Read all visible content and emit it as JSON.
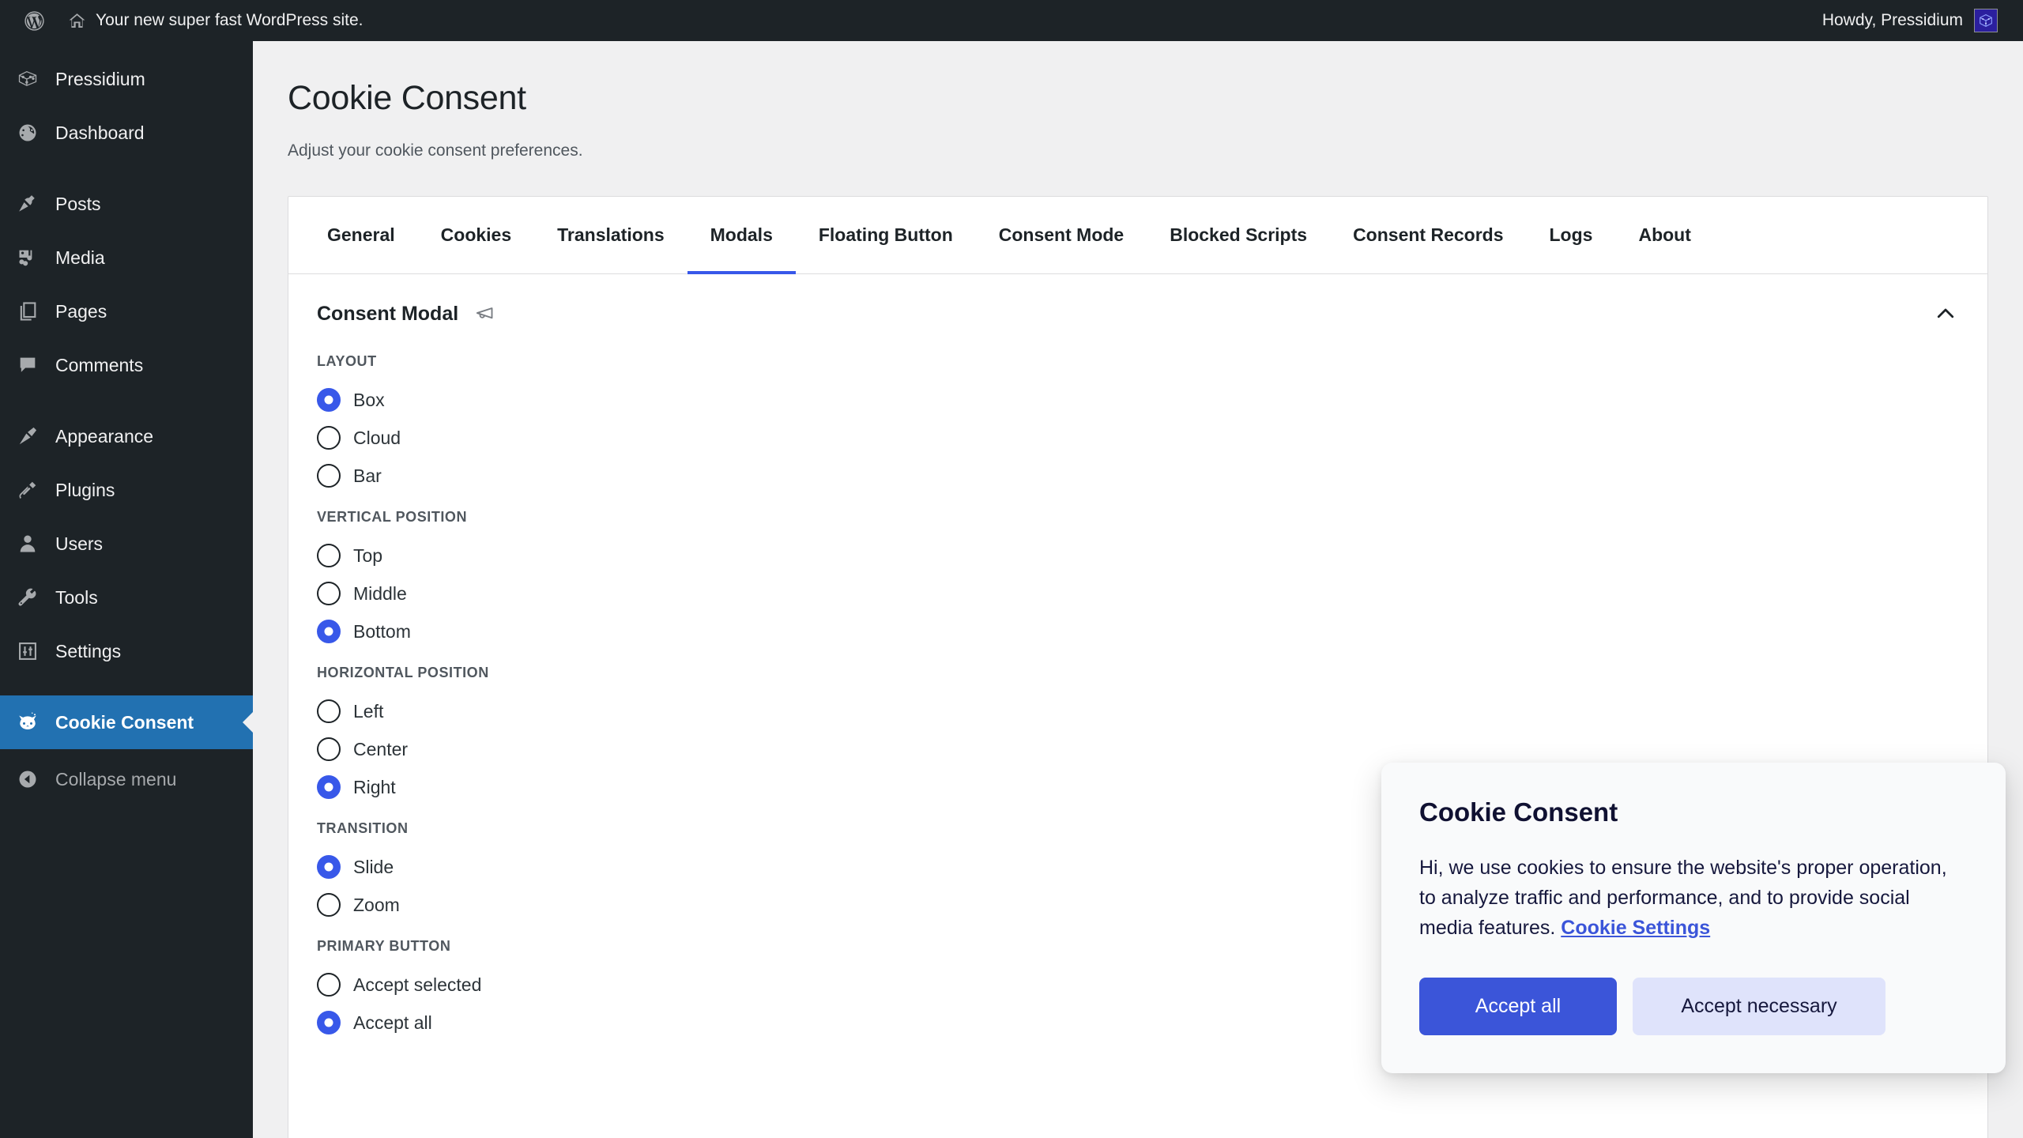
{
  "adminbar": {
    "wp_logo_icon": "wordpress-logo-icon",
    "site_home_icon": "home-icon",
    "site_name": "Your new super fast WordPress site.",
    "howdy": "Howdy, Pressidium",
    "avatar_icon": "avatar-icon"
  },
  "sidebar": {
    "items": [
      {
        "label": "Pressidium",
        "icon": "pressidium-icon",
        "key": "pressidium"
      },
      {
        "label": "Dashboard",
        "icon": "dashboard-icon",
        "key": "dashboard"
      },
      {
        "label": "Posts",
        "icon": "pin-icon",
        "key": "posts"
      },
      {
        "label": "Media",
        "icon": "media-icon",
        "key": "media"
      },
      {
        "label": "Pages",
        "icon": "pages-icon",
        "key": "pages"
      },
      {
        "label": "Comments",
        "icon": "comment-icon",
        "key": "comments"
      },
      {
        "label": "Appearance",
        "icon": "paintbrush-icon",
        "key": "appearance"
      },
      {
        "label": "Plugins",
        "icon": "plug-icon",
        "key": "plugins"
      },
      {
        "label": "Users",
        "icon": "user-icon",
        "key": "users"
      },
      {
        "label": "Tools",
        "icon": "wrench-icon",
        "key": "tools"
      },
      {
        "label": "Settings",
        "icon": "sliders-icon",
        "key": "settings"
      },
      {
        "label": "Cookie Consent",
        "icon": "cat-icon",
        "key": "cookie-consent"
      }
    ],
    "collapse": {
      "label": "Collapse menu",
      "icon": "collapse-arrow-icon"
    },
    "active_key": "cookie-consent",
    "active_color": "#2271b1"
  },
  "page": {
    "title": "Cookie Consent",
    "subtitle": "Adjust your cookie consent preferences."
  },
  "tabs": {
    "items": [
      "General",
      "Cookies",
      "Translations",
      "Modals",
      "Floating Button",
      "Consent Mode",
      "Blocked Scripts",
      "Consent Records",
      "Logs",
      "About"
    ],
    "active": "Modals",
    "active_underline_color": "#3858e9"
  },
  "section": {
    "title": "Consent Modal",
    "icon": "megaphone-icon",
    "collapse_icon": "chevron-up-icon",
    "expanded": true
  },
  "settings_groups": [
    {
      "label": "LAYOUT",
      "name": "layout",
      "options": [
        {
          "label": "Box",
          "selected": true
        },
        {
          "label": "Cloud",
          "selected": false
        },
        {
          "label": "Bar",
          "selected": false
        }
      ]
    },
    {
      "label": "VERTICAL POSITION",
      "name": "vertical-position",
      "options": [
        {
          "label": "Top",
          "selected": false
        },
        {
          "label": "Middle",
          "selected": false
        },
        {
          "label": "Bottom",
          "selected": true
        }
      ]
    },
    {
      "label": "HORIZONTAL POSITION",
      "name": "horizontal-position",
      "options": [
        {
          "label": "Left",
          "selected": false
        },
        {
          "label": "Center",
          "selected": false
        },
        {
          "label": "Right",
          "selected": true
        }
      ]
    },
    {
      "label": "TRANSITION",
      "name": "transition",
      "options": [
        {
          "label": "Slide",
          "selected": true
        },
        {
          "label": "Zoom",
          "selected": false
        }
      ]
    },
    {
      "label": "PRIMARY BUTTON",
      "name": "primary-button",
      "options": [
        {
          "label": "Accept selected",
          "selected": false
        },
        {
          "label": "Accept all",
          "selected": true
        }
      ]
    }
  ],
  "consent_popup": {
    "title": "Cookie Consent",
    "body_before_link": "Hi, we use cookies to ensure the website's proper operation, to analyze traffic and performance, and to provide social media features. ",
    "link_label": "Cookie Settings",
    "primary_button": "Accept all",
    "secondary_button": "Accept necessary",
    "primary_color": "#3b55d9",
    "secondary_bg": "#dfe3fb"
  }
}
